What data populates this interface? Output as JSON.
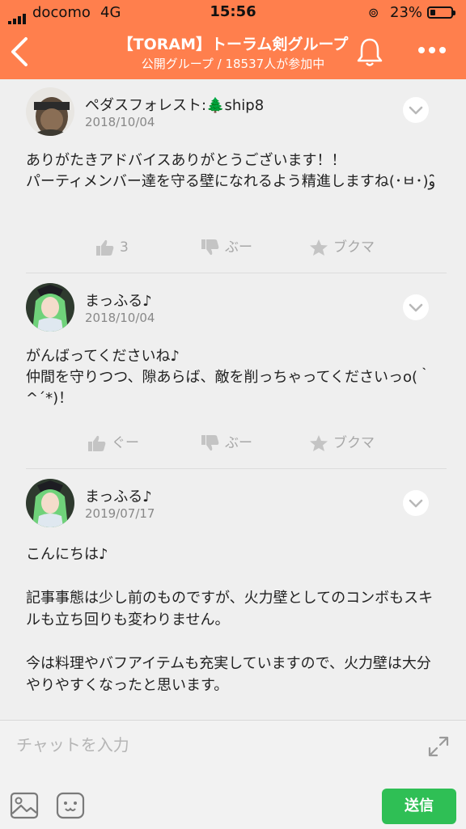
{
  "status_bar": {
    "carrier": "docomo",
    "network": "4G",
    "time": "15:56",
    "battery": "23%",
    "battery_level": 0.23
  },
  "header": {
    "title": "【TORAM】トーラム剣グループ",
    "subtitle": "公開グループ / 18537人が参加中"
  },
  "comments": [
    {
      "author": "ペダスフォレスト:🌲ship8",
      "date": "2018/10/04",
      "text": "ありがたきアドバイスありがとうございます！！\nパーティメンバー達を守る壁になれるよう精進しますね(･ㅂ･)و ̑̑",
      "like_label": "3",
      "dislike_label": "ぶー",
      "bookmark_label": "ブクマ"
    },
    {
      "author": "まっふる♪",
      "date": "2018/10/04",
      "text": "がんばってくださいね♪\n仲間を守りつつ、隙あらば、敵を削っちゃってくださいっo(｀^´*)！",
      "like_label": "ぐー",
      "dislike_label": "ぶー",
      "bookmark_label": "ブクマ"
    },
    {
      "author": "まっふる♪",
      "date": "2019/07/17",
      "text": "こんにちは♪\n\n記事事態は少し前のものですが、火力壁としてのコンボもスキルも立ち回りも変わりません。\n\n今は料理やバフアイテムも充実していますので、火力壁は大分やりやすくなったと思います。\n\n良き火力壁を作って、ソロ、パテとも楽しんでください",
      "like_label": "",
      "dislike_label": "",
      "bookmark_label": ""
    }
  ],
  "composer": {
    "placeholder": "チャットを入力",
    "send_label": "送信"
  },
  "icons": {
    "back": "chevron-left-icon",
    "bell": "bell-icon",
    "more": "more-dots-icon",
    "expand": "expand-icon",
    "image": "image-icon",
    "emoji": "emoji-icon",
    "like": "thumbs-up-icon",
    "dislike": "thumbs-down-icon",
    "bookmark": "star-icon"
  },
  "colors": {
    "header": "#ff7f4d",
    "send": "#2fbf55",
    "background": "#efefef"
  }
}
